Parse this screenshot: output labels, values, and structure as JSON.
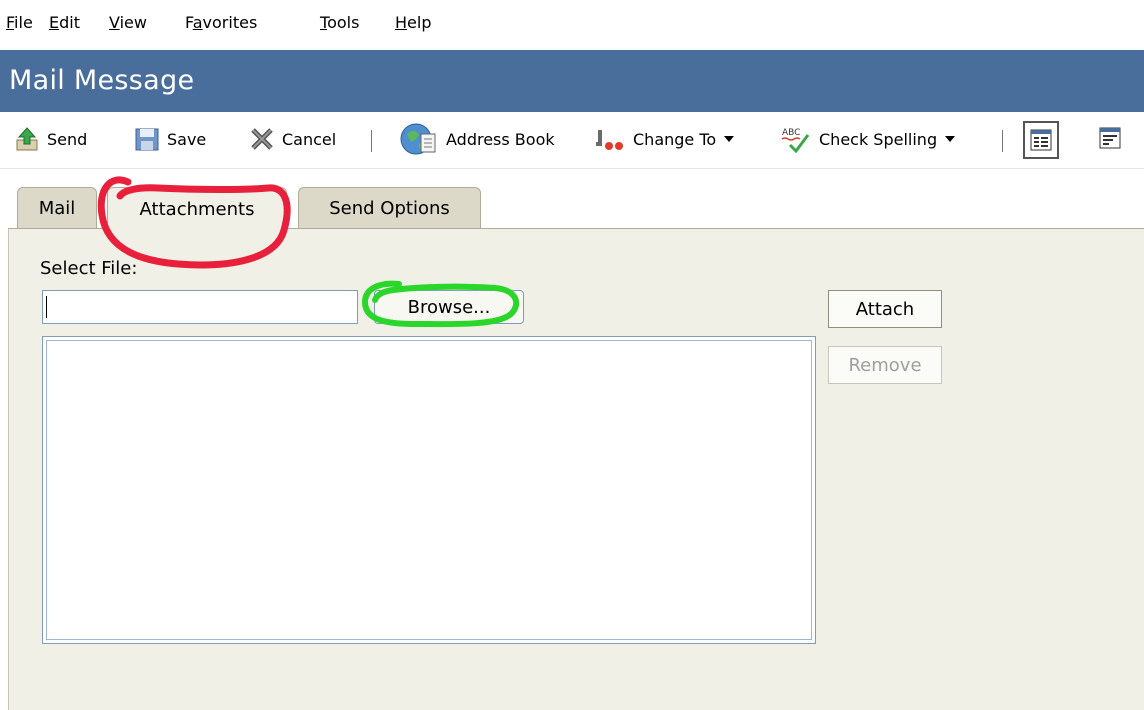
{
  "menu": {
    "items": [
      {
        "label": "File"
      },
      {
        "label": "Edit"
      },
      {
        "label": "View"
      },
      {
        "label": "Favorites"
      },
      {
        "label": "Tools"
      },
      {
        "label": "Help"
      }
    ]
  },
  "window": {
    "title": "Mail Message"
  },
  "toolbar": {
    "send_label": "Send",
    "save_label": "Save",
    "cancel_label": "Cancel",
    "address_book_label": "Address Book",
    "change_to_label": "Change To",
    "check_spelling_label": "Check Spelling"
  },
  "tabs": [
    {
      "label": "Mail",
      "active": false
    },
    {
      "label": "Attachments",
      "active": true
    },
    {
      "label": "Send Options",
      "active": false
    }
  ],
  "attachments": {
    "select_file_label": "Select File:",
    "file_path_value": "",
    "browse_label": "Browse...",
    "attach_label": "Attach",
    "remove_label": "Remove",
    "remove_enabled": false,
    "attached_files": []
  },
  "annotations": [
    {
      "target": "tab-attachments",
      "color": "#e8203c"
    },
    {
      "target": "browse-button",
      "color": "#2bd62b"
    }
  ]
}
